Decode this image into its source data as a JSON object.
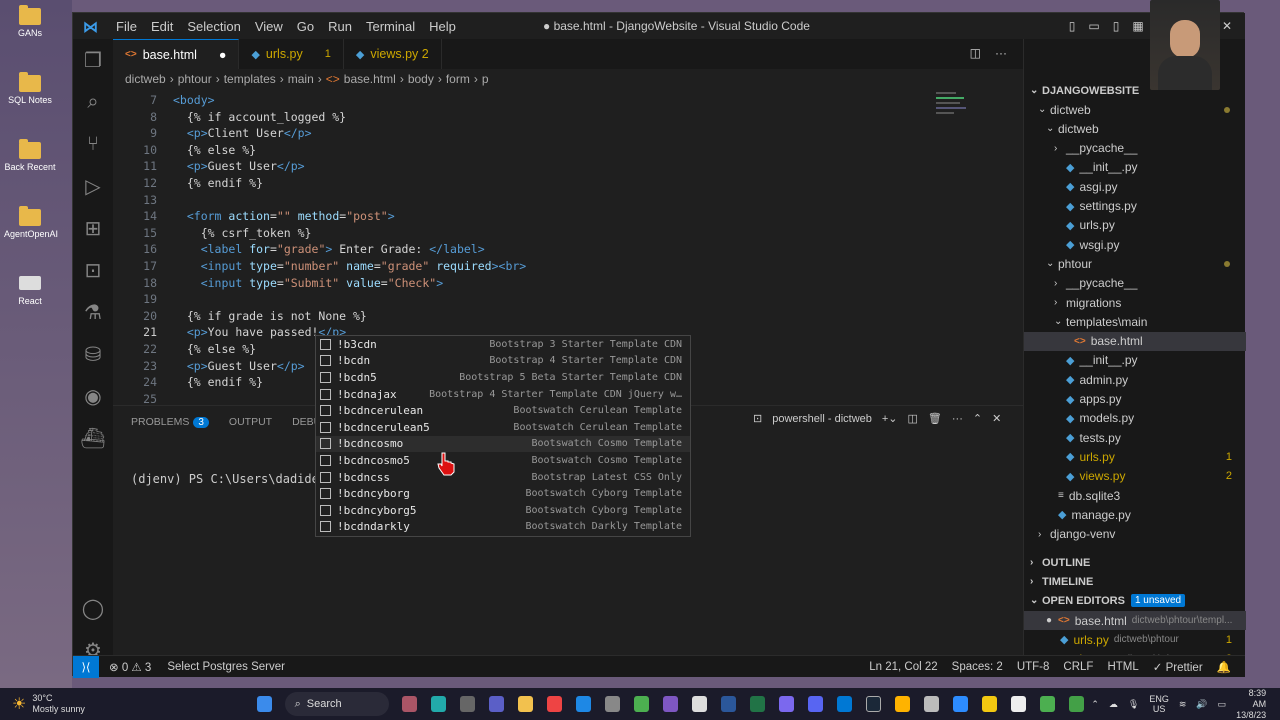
{
  "desktop": {
    "icons": [
      "GANs",
      "SQL Notes",
      "Back Recent",
      "AgentOpenAI",
      "React"
    ]
  },
  "window": {
    "menu": [
      "File",
      "Edit",
      "Selection",
      "View",
      "Go",
      "Run",
      "Terminal",
      "Help"
    ],
    "title": "● base.html - DjangoWebsite - Visual Studio Code"
  },
  "tabs": [
    {
      "label": "base.html",
      "icon": "html-icon",
      "extra": "●"
    },
    {
      "label": "urls.py",
      "icon": "python-icon",
      "extra": "1"
    },
    {
      "label": "views.py 2",
      "icon": "python-icon",
      "extra": ""
    }
  ],
  "breadcrumbs": [
    "dictweb",
    "phtour",
    "templates",
    "main",
    "base.html",
    "body",
    "form",
    "p"
  ],
  "editor": {
    "lines": [
      {
        "n": "7",
        "html": "<span class='t'>&lt;body&gt;</span>"
      },
      {
        "n": "8",
        "html": "  {% if account_logged %}"
      },
      {
        "n": "9",
        "html": "  <span class='t'>&lt;p&gt;</span>Client User<span class='t'>&lt;/p&gt;</span>"
      },
      {
        "n": "10",
        "html": "  {% else %}"
      },
      {
        "n": "11",
        "html": "  <span class='t'>&lt;p&gt;</span>Guest User<span class='t'>&lt;/p&gt;</span>"
      },
      {
        "n": "12",
        "html": "  {% endif %}"
      },
      {
        "n": "13",
        "html": ""
      },
      {
        "n": "14",
        "html": "  <span class='t'>&lt;form</span> <span class='a'>action</span>=<span class='s'>\"\"</span> <span class='a'>method</span>=<span class='s'>\"post\"</span><span class='t'>&gt;</span>"
      },
      {
        "n": "15",
        "html": "    {% csrf_token %}"
      },
      {
        "n": "16",
        "html": "    <span class='t'>&lt;label</span> <span class='a'>for</span>=<span class='s'>\"grade\"</span><span class='t'>&gt;</span> Enter Grade: <span class='t'>&lt;/label&gt;</span>"
      },
      {
        "n": "17",
        "html": "    <span class='t'>&lt;input</span> <span class='a'>type</span>=<span class='s'>\"number\"</span> <span class='a'>name</span>=<span class='s'>\"grade\"</span> <span class='a'>required</span><span class='t'>&gt;&lt;br&gt;</span>"
      },
      {
        "n": "18",
        "html": "    <span class='t'>&lt;input</span> <span class='a'>type</span>=<span class='s'>\"Submit\"</span> <span class='a'>value</span>=<span class='s'>\"Check\"</span><span class='t'>&gt;</span>"
      },
      {
        "n": "19",
        "html": ""
      },
      {
        "n": "20",
        "html": "  {% if grade is not None %}"
      },
      {
        "n": "21",
        "html": "  <span class='t'>&lt;p&gt;</span>You have passed!<span class='t'>&lt;/p&gt;</span>"
      },
      {
        "n": "22",
        "html": "  {% else %}"
      },
      {
        "n": "23",
        "html": "  <span class='t'>&lt;p&gt;</span>Guest User<span class='t'>&lt;/p&gt;</span>"
      },
      {
        "n": "24",
        "html": "  {% endif %}"
      },
      {
        "n": "25",
        "html": ""
      }
    ]
  },
  "suggestions": [
    {
      "label": "!b3cdn",
      "detail": "Bootstrap 3 Starter Template CDN"
    },
    {
      "label": "!bcdn",
      "detail": "Bootstrap 4 Starter Template CDN"
    },
    {
      "label": "!bcdn5",
      "detail": "Bootstrap 5 Beta Starter Template CDN"
    },
    {
      "label": "!bcdnajax",
      "detail": "Bootstrap 4 Starter Template CDN jQuery w…"
    },
    {
      "label": "!bcdncerulean",
      "detail": "Bootswatch Cerulean Template"
    },
    {
      "label": "!bcdncerulean5",
      "detail": "Bootswatch Cerulean Template"
    },
    {
      "label": "!bcdncosmo",
      "detail": "Bootswatch Cosmo Template"
    },
    {
      "label": "!bcdncosmo5",
      "detail": "Bootswatch Cosmo Template"
    },
    {
      "label": "!bcdncss",
      "detail": "Bootstrap Latest CSS Only"
    },
    {
      "label": "!bcdncyborg",
      "detail": "Bootswatch Cyborg Template"
    },
    {
      "label": "!bcdncyborg5",
      "detail": "Bootswatch Cyborg Template"
    },
    {
      "label": "!bcdndarkly",
      "detail": "Bootswatch Darkly Template"
    }
  ],
  "panel": {
    "tabs": [
      "PROBLEMS",
      "OUTPUT",
      "DEBUG C"
    ],
    "problems_count": "3",
    "terminal_name": "powershell - dictweb",
    "prompt": "(djenv) PS C:\\Users\\dadidelu"
  },
  "explorer": {
    "root": "DJANGOWEBSITE",
    "items": [
      {
        "label": "dictweb",
        "indent": 1,
        "type": "folder-open",
        "dot": true
      },
      {
        "label": "dictweb",
        "indent": 2,
        "type": "folder-open"
      },
      {
        "label": "__pycache__",
        "indent": 3,
        "type": "folder"
      },
      {
        "label": "__init__.py",
        "indent": 3,
        "type": "py"
      },
      {
        "label": "asgi.py",
        "indent": 3,
        "type": "py"
      },
      {
        "label": "settings.py",
        "indent": 3,
        "type": "py"
      },
      {
        "label": "urls.py",
        "indent": 3,
        "type": "py"
      },
      {
        "label": "wsgi.py",
        "indent": 3,
        "type": "py"
      },
      {
        "label": "phtour",
        "indent": 2,
        "type": "folder-open",
        "dot": true
      },
      {
        "label": "__pycache__",
        "indent": 3,
        "type": "folder"
      },
      {
        "label": "migrations",
        "indent": 3,
        "type": "folder"
      },
      {
        "label": "templates\\main",
        "indent": 3,
        "type": "folder-open"
      },
      {
        "label": "base.html",
        "indent": 4,
        "type": "html",
        "selected": true
      },
      {
        "label": "__init__.py",
        "indent": 3,
        "type": "py"
      },
      {
        "label": "admin.py",
        "indent": 3,
        "type": "py"
      },
      {
        "label": "apps.py",
        "indent": 3,
        "type": "py"
      },
      {
        "label": "models.py",
        "indent": 3,
        "type": "py"
      },
      {
        "label": "tests.py",
        "indent": 3,
        "type": "py"
      },
      {
        "label": "urls.py",
        "indent": 3,
        "type": "py",
        "count": "1",
        "warn": true
      },
      {
        "label": "views.py",
        "indent": 3,
        "type": "py",
        "count": "2",
        "warn": true
      },
      {
        "label": "db.sqlite3",
        "indent": 2,
        "type": "db"
      },
      {
        "label": "manage.py",
        "indent": 2,
        "type": "py"
      },
      {
        "label": "django-venv",
        "indent": 1,
        "type": "folder"
      }
    ],
    "outline": "OUTLINE",
    "timeline": "TIMELINE",
    "open_editors": "OPEN EDITORS",
    "unsaved": "1 unsaved",
    "open": [
      {
        "label": "base.html",
        "path": "dictweb\\phtour\\templ...",
        "type": "html",
        "count": ""
      },
      {
        "label": "urls.py",
        "path": "dictweb\\phtour",
        "type": "py",
        "count": "1"
      },
      {
        "label": "views.py",
        "path": "dictweb\\phtour",
        "type": "py",
        "count": "2"
      }
    ]
  },
  "status": {
    "errors": "⊗ 0 ⚠ 3",
    "db": "Select Postgres Server",
    "pos": "Ln 21, Col 22",
    "spaces": "Spaces: 2",
    "enc": "UTF-8",
    "eol": "CRLF",
    "lang": "HTML",
    "prettier": "✓ Prettier"
  },
  "taskbar": {
    "weather_temp": "30°C",
    "weather_desc": "Mostly sunny",
    "search": "Search",
    "lang1": "ENG",
    "lang2": "US",
    "time": "8:39 AM",
    "date": "13/8/23"
  }
}
